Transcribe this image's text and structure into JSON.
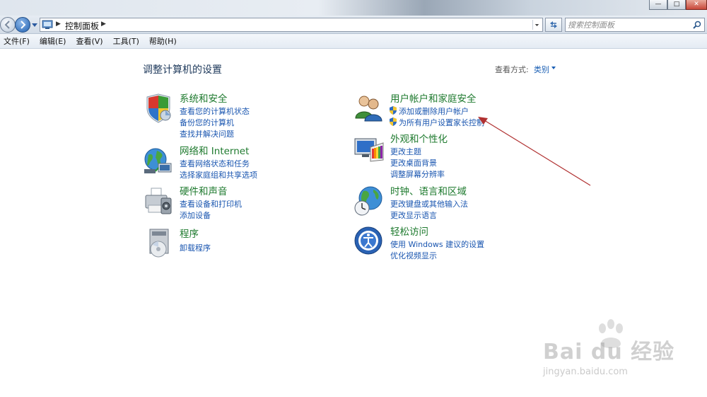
{
  "address_bar": {
    "breadcrumb": "控制面板",
    "search_placeholder": "搜索控制面板"
  },
  "menu": {
    "items": [
      "文件(F)",
      "编辑(E)",
      "查看(V)",
      "工具(T)",
      "帮助(H)"
    ]
  },
  "main": {
    "title": "调整计算机的设置",
    "view_by_label": "查看方式:",
    "view_by_value": "类别",
    "categories": [
      {
        "title": "系统和安全",
        "icon": "shield-icon",
        "links": [
          "查看您的计算机状态",
          "备份您的计算机",
          "查找并解决问题"
        ]
      },
      {
        "title": "网络和 Internet",
        "icon": "network-globe-icon",
        "links": [
          "查看网络状态和任务",
          "选择家庭组和共享选项"
        ]
      },
      {
        "title": "硬件和声音",
        "icon": "printer-icon",
        "links": [
          "查看设备和打印机",
          "添加设备"
        ]
      },
      {
        "title": "程序",
        "icon": "programs-disc-icon",
        "links": [
          "卸载程序"
        ]
      },
      {
        "title": "用户帐户和家庭安全",
        "icon": "users-icon",
        "links": [
          "添加或删除用户帐户",
          "为所有用户设置家长控制"
        ]
      },
      {
        "title": "外观和个性化",
        "icon": "monitor-palette-icon",
        "links": [
          "更改主题",
          "更改桌面背景",
          "调整屏幕分辨率"
        ]
      },
      {
        "title": "时钟、语言和区域",
        "icon": "globe-clock-icon",
        "links": [
          "更改键盘或其他输入法",
          "更改显示语言"
        ]
      },
      {
        "title": "轻松访问",
        "icon": "ease-of-access-icon",
        "links": [
          "使用 Windows 建议的设置",
          "优化视频显示"
        ]
      }
    ]
  },
  "watermark": {
    "brand": "Bai du 经验",
    "url": "jingyan.baidu.com"
  },
  "colors": {
    "category_title": "#1e7a2e",
    "link": "#1a56b0",
    "page_title": "#1e395b",
    "annotation_arrow": "#b03030"
  }
}
